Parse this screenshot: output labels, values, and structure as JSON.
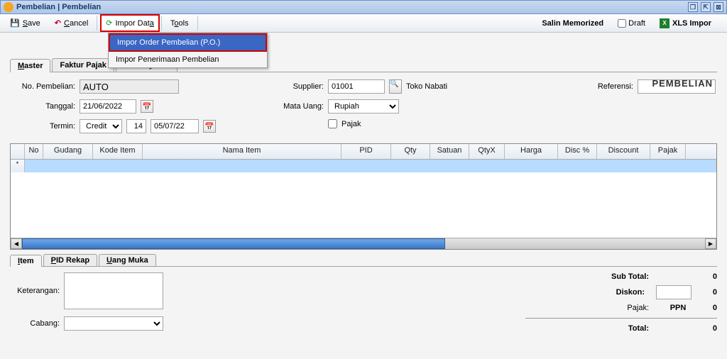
{
  "title": "Pembelian | Pembelian",
  "toolbar": {
    "save": "Save",
    "cancel": "Cancel",
    "import_data": "Impor Data",
    "tools": "Tools",
    "salin_memorized": "Salin Memorized",
    "draft_label": "Draft",
    "xls_impor": "XLS Impor"
  },
  "dropdown": {
    "item1": "Impor Order Pembelian (P.O.)",
    "item2": "Impor Penerimaan Pembelian"
  },
  "section_title": "PEMBELIAN",
  "tabs": {
    "master": "Master",
    "faktur": "Faktur Pajak",
    "pembayaran": "Pembayaran"
  },
  "fields": {
    "no_pembelian_label": "No. Pembelian:",
    "no_pembelian_value": "AUTO",
    "tanggal_label": "Tanggal:",
    "tanggal_value": "21/06/2022",
    "termin_label": "Termin:",
    "termin_type": "Credit",
    "termin_days": "14",
    "termin_due": "05/07/22",
    "supplier_label": "Supplier:",
    "supplier_code": "01001",
    "supplier_name": "Toko Nabati",
    "mata_uang_label": "Mata Uang:",
    "mata_uang_value": "Rupiah",
    "pajak_label": "Pajak",
    "referensi_label": "Referensi:"
  },
  "grid_headers": [
    "No",
    "Gudang",
    "Kode Item",
    "Nama Item",
    "PID",
    "Qty",
    "Satuan",
    "QtyX",
    "Harga",
    "Disc %",
    "Discount",
    "Pajak"
  ],
  "sub_tabs": {
    "item": "Item",
    "pid_rekap": "PID Rekap",
    "uang_muka": "Uang Muka"
  },
  "footer": {
    "keterangan_label": "Keterangan:",
    "cabang_label": "Cabang:"
  },
  "totals": {
    "subtotal_label": "Sub Total:",
    "subtotal_val": "0",
    "diskon_label": "Diskon:",
    "diskon_val": "0",
    "pajak_label": "Pajak:",
    "pajak_type": "PPN",
    "pajak_val": "0",
    "total_label": "Total:",
    "total_val": "0"
  }
}
